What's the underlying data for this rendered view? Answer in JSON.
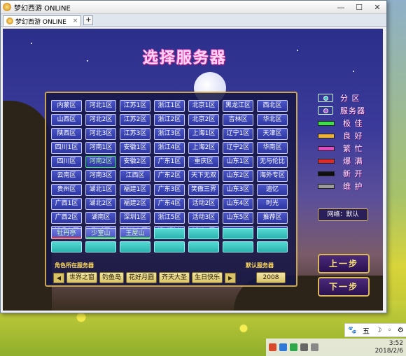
{
  "window": {
    "title": "梦幻西游 ONLINE",
    "tab_label": "梦幻西游 ONLINE",
    "close_tab": "×",
    "new_tab": "+",
    "min": "—",
    "max": "☐",
    "close": "✕"
  },
  "game": {
    "heading": "选择服务器",
    "servers": [
      [
        "内蒙区",
        "河北1区",
        "江苏1区",
        "浙江1区",
        "北京1区",
        "黑龙江区",
        "西北区"
      ],
      [
        "山西区",
        "河北2区",
        "江苏2区",
        "浙江2区",
        "北京2区",
        "吉林区",
        "华北区"
      ],
      [
        "陕西区",
        "河北3区",
        "江苏3区",
        "浙江3区",
        "上海1区",
        "辽宁1区",
        "天津区"
      ],
      [
        "四川1区",
        "河南1区",
        "安徽1区",
        "浙江4区",
        "上海2区",
        "辽宁2区",
        "华南区"
      ],
      [
        "四川区",
        "河南2区",
        "安徽2区",
        "广东1区",
        "重庆区",
        "山东1区",
        "无与伦比"
      ],
      [
        "云南区",
        "河南3区",
        "江西区",
        "广东2区",
        "天下无双",
        "山东2区",
        "海外专区"
      ],
      [
        "贵州区",
        "湖北1区",
        "福建1区",
        "广东3区",
        "笑傲三界",
        "山东3区",
        "追忆"
      ],
      [
        "广西1区",
        "湖北2区",
        "福建2区",
        "广东4区",
        "活动2区",
        "山东4区",
        "时光"
      ],
      [
        "广西2区",
        "湖南区",
        "深圳1区",
        "浙江5区",
        "活动3区",
        "山东5区",
        "推荐区"
      ],
      [
        "新手专区",
        "测试区",
        "活动专区",
        "帮派联赛",
        "活动1区",
        "",
        ""
      ]
    ],
    "recent_row1": [
      "牡丹亭",
      "少室山",
      "王屋山",
      "",
      "",
      "",
      ""
    ],
    "recent_row2": [
      "",
      "",
      "",
      "",
      "",
      "",
      ""
    ],
    "role_label": "角色所在服务器",
    "default_label": "默认服务器",
    "role_servers": [
      "世界之窗",
      "钓鱼岛",
      "花好月圆",
      "齐天大圣",
      "生日快乐"
    ],
    "default_server": "2008",
    "legend": [
      {
        "label": "分 区",
        "kind": "ring",
        "color": "#3cc6c0"
      },
      {
        "label": "服务器",
        "kind": "ring",
        "color": "#a05ad8"
      },
      {
        "label": "极 佳",
        "kind": "bar",
        "color": "#3ee04a"
      },
      {
        "label": "良 好",
        "kind": "bar",
        "color": "#f0b030"
      },
      {
        "label": "繁 忙",
        "kind": "bar",
        "color": "#e04ac0"
      },
      {
        "label": "爆 满",
        "kind": "bar",
        "color": "#e02a2a"
      },
      {
        "label": "新 开",
        "kind": "bar",
        "color": "#101010"
      },
      {
        "label": "维 护",
        "kind": "bar",
        "color": "#9a9a9a"
      }
    ],
    "network": "网络：默认",
    "prev_button": "上一步",
    "next_button": "下一步"
  },
  "side_tools": [
    "🐾",
    "五",
    "☽",
    "◦",
    "⚙"
  ],
  "taskbar": {
    "time": "3:52",
    "date": "2018/2/6"
  }
}
